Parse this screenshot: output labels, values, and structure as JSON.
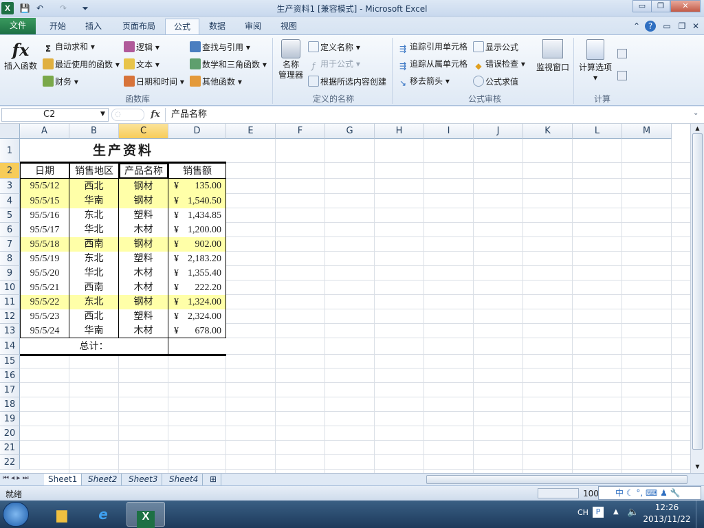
{
  "window": {
    "title": "生产资料1  [兼容模式] - Microsoft Excel",
    "minimize": "▭",
    "maximize": "❐",
    "close": "✕"
  },
  "qat": {
    "save": "💾",
    "undo": "↶",
    "redo": "↷",
    "customize": "⏷"
  },
  "tabs": [
    {
      "label": "文件"
    },
    {
      "label": "开始"
    },
    {
      "label": "插入"
    },
    {
      "label": "页面布局"
    },
    {
      "label": "公式"
    },
    {
      "label": "数据"
    },
    {
      "label": "审阅"
    },
    {
      "label": "视图"
    }
  ],
  "ribbon": {
    "function_library": {
      "label": "函数库",
      "insert_function": "插入函数",
      "autosum": "自动求和",
      "recent": "最近使用的函数",
      "financial": "财务",
      "logical": "逻辑",
      "text": "文本",
      "datetime": "日期和时间",
      "lookup": "查找与引用",
      "math": "数学和三角函数",
      "more": "其他函数"
    },
    "defined_names": {
      "label": "定义的名称",
      "name_manager_1": "名称",
      "name_manager_2": "管理器",
      "define_name": "定义名称",
      "use_in_formula": "用于公式",
      "create_from_selection": "根据所选内容创建"
    },
    "formula_auditing": {
      "label": "公式审核",
      "trace_precedents": "追踪引用单元格",
      "trace_dependents": "追踪从属单元格",
      "remove_arrows": "移去箭头",
      "show_formulas": "显示公式",
      "error_checking": "错误检查",
      "evaluate_formula": "公式求值",
      "watch_window": "监视窗口"
    },
    "calculation": {
      "label": "计算",
      "options": "计算选项"
    }
  },
  "formula_bar": {
    "name_box": "C2",
    "fx": "fx",
    "value": "产品名称"
  },
  "columns": [
    "A",
    "B",
    "C",
    "D",
    "E",
    "F",
    "G",
    "H",
    "I",
    "J",
    "K",
    "L",
    "M"
  ],
  "rows": [
    "1",
    "2",
    "3",
    "4",
    "5",
    "6",
    "7",
    "8",
    "9",
    "10",
    "11",
    "12",
    "13",
    "14",
    "15",
    "16",
    "17",
    "18",
    "19",
    "20",
    "21",
    "22"
  ],
  "sheet": {
    "title": "生产资料",
    "headers": [
      "日期",
      "销售地区",
      "产品名称",
      "销售额"
    ],
    "data": [
      {
        "date": "95/5/12",
        "region": "西北",
        "product": "钢材",
        "cur": "¥",
        "amount": "135.00",
        "highlight": true
      },
      {
        "date": "95/5/15",
        "region": "华南",
        "product": "钢材",
        "cur": "¥",
        "amount": "1,540.50",
        "highlight": true
      },
      {
        "date": "95/5/16",
        "region": "东北",
        "product": "塑料",
        "cur": "¥",
        "amount": "1,434.85",
        "highlight": false
      },
      {
        "date": "95/5/17",
        "region": "华北",
        "product": "木材",
        "cur": "¥",
        "amount": "1,200.00",
        "highlight": false
      },
      {
        "date": "95/5/18",
        "region": "西南",
        "product": "钢材",
        "cur": "¥",
        "amount": "902.00",
        "highlight": true
      },
      {
        "date": "95/5/19",
        "region": "东北",
        "product": "塑料",
        "cur": "¥",
        "amount": "2,183.20",
        "highlight": false
      },
      {
        "date": "95/5/20",
        "region": "华北",
        "product": "木材",
        "cur": "¥",
        "amount": "1,355.40",
        "highlight": false
      },
      {
        "date": "95/5/21",
        "region": "西南",
        "product": "木材",
        "cur": "¥",
        "amount": "222.20",
        "highlight": false
      },
      {
        "date": "95/5/22",
        "region": "东北",
        "product": "钢材",
        "cur": "¥",
        "amount": "1,324.00",
        "highlight": true
      },
      {
        "date": "95/5/23",
        "region": "西北",
        "product": "塑料",
        "cur": "¥",
        "amount": "2,324.00",
        "highlight": false
      },
      {
        "date": "95/5/24",
        "region": "华南",
        "product": "木材",
        "cur": "¥",
        "amount": "678.00",
        "highlight": false
      }
    ],
    "total_label": "总计："
  },
  "sheet_tabs": [
    "Sheet1",
    "Sheet2",
    "Sheet3",
    "Sheet4"
  ],
  "status": {
    "ready": "就绪",
    "zoom": "100"
  },
  "ime": {
    "label": "中"
  },
  "taskbar": {
    "lang": "CH",
    "time": "12:26",
    "date": "2013/11/22"
  },
  "colors": {
    "highlight": "#ffffa8",
    "selected_header": "#f7cc59",
    "file_tab": "#1d7044"
  }
}
